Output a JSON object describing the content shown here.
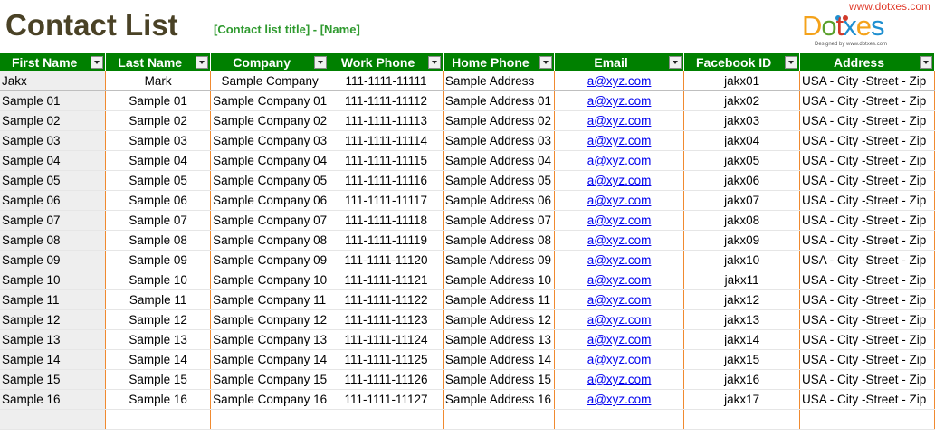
{
  "page": {
    "title": "Contact List",
    "subtitle": "[Contact list title] - [Name]",
    "site_url": "www.dotxes.com",
    "logo": {
      "letters": [
        "D",
        "o",
        "t",
        "x",
        "e",
        "s"
      ],
      "letter_colors": [
        "#f4a21a",
        "#5aa02c",
        "#d23a2a",
        "#1f8fd0",
        "#f4a21a",
        "#1f8fd0"
      ],
      "tagline": "Designed by www.dotxes.com"
    }
  },
  "colors": {
    "header_bg": "#008000",
    "grid_line": "#f08a30",
    "title_text": "#4a4226",
    "subtitle_text": "#2f9a2f",
    "url_text": "#e03a2a",
    "link": "#0000ee"
  },
  "table": {
    "columns": [
      "First Name",
      "Last Name",
      "Company",
      "Work Phone",
      "Home Phone",
      "Email",
      "Facebook ID",
      "Address"
    ],
    "rows": [
      [
        "Jakx",
        "Mark",
        "Sample Company",
        "111-1111-11111",
        "Sample Address",
        "a@xyz.com",
        "jakx01",
        "USA - City -Street - Zip"
      ],
      [
        "Sample 01",
        "Sample 01",
        "Sample Company 01",
        "111-1111-11112",
        "Sample Address 01",
        "a@xyz.com",
        "jakx02",
        "USA - City -Street - Zip"
      ],
      [
        "Sample 02",
        "Sample 02",
        "Sample Company 02",
        "111-1111-11113",
        "Sample Address 02",
        "a@xyz.com",
        "jakx03",
        "USA - City -Street - Zip"
      ],
      [
        "Sample 03",
        "Sample 03",
        "Sample Company 03",
        "111-1111-11114",
        "Sample Address 03",
        "a@xyz.com",
        "jakx04",
        "USA - City -Street - Zip"
      ],
      [
        "Sample 04",
        "Sample 04",
        "Sample Company 04",
        "111-1111-11115",
        "Sample Address 04",
        "a@xyz.com",
        "jakx05",
        "USA - City -Street - Zip"
      ],
      [
        "Sample 05",
        "Sample 05",
        "Sample Company 05",
        "111-1111-11116",
        "Sample Address 05",
        "a@xyz.com",
        "jakx06",
        "USA - City -Street - Zip"
      ],
      [
        "Sample 06",
        "Sample 06",
        "Sample Company 06",
        "111-1111-11117",
        "Sample Address 06",
        "a@xyz.com",
        "jakx07",
        "USA - City -Street - Zip"
      ],
      [
        "Sample 07",
        "Sample 07",
        "Sample Company 07",
        "111-1111-11118",
        "Sample Address 07",
        "a@xyz.com",
        "jakx08",
        "USA - City -Street - Zip"
      ],
      [
        "Sample 08",
        "Sample 08",
        "Sample Company 08",
        "111-1111-11119",
        "Sample Address 08",
        "a@xyz.com",
        "jakx09",
        "USA - City -Street - Zip"
      ],
      [
        "Sample 09",
        "Sample 09",
        "Sample Company 09",
        "111-1111-11120",
        "Sample Address 09",
        "a@xyz.com",
        "jakx10",
        "USA - City -Street - Zip"
      ],
      [
        "Sample 10",
        "Sample 10",
        "Sample Company 10",
        "111-1111-11121",
        "Sample Address 10",
        "a@xyz.com",
        "jakx11",
        "USA - City -Street - Zip"
      ],
      [
        "Sample 11",
        "Sample 11",
        "Sample Company 11",
        "111-1111-11122",
        "Sample Address 11",
        "a@xyz.com",
        "jakx12",
        "USA - City -Street - Zip"
      ],
      [
        "Sample 12",
        "Sample 12",
        "Sample Company 12",
        "111-1111-11123",
        "Sample Address 12",
        "a@xyz.com",
        "jakx13",
        "USA - City -Street - Zip"
      ],
      [
        "Sample 13",
        "Sample 13",
        "Sample Company 13",
        "111-1111-11124",
        "Sample Address 13",
        "a@xyz.com",
        "jakx14",
        "USA - City -Street - Zip"
      ],
      [
        "Sample 14",
        "Sample 14",
        "Sample Company 14",
        "111-1111-11125",
        "Sample Address 14",
        "a@xyz.com",
        "jakx15",
        "USA - City -Street - Zip"
      ],
      [
        "Sample 15",
        "Sample 15",
        "Sample Company 15",
        "111-1111-11126",
        "Sample Address 15",
        "a@xyz.com",
        "jakx16",
        "USA - City -Street - Zip"
      ],
      [
        "Sample 16",
        "Sample 16",
        "Sample Company 16",
        "111-1111-11127",
        "Sample Address 16",
        "a@xyz.com",
        "jakx17",
        "USA - City -Street - Zip"
      ],
      [
        "",
        "",
        "",
        "",
        "",
        "",
        "",
        ""
      ]
    ]
  }
}
